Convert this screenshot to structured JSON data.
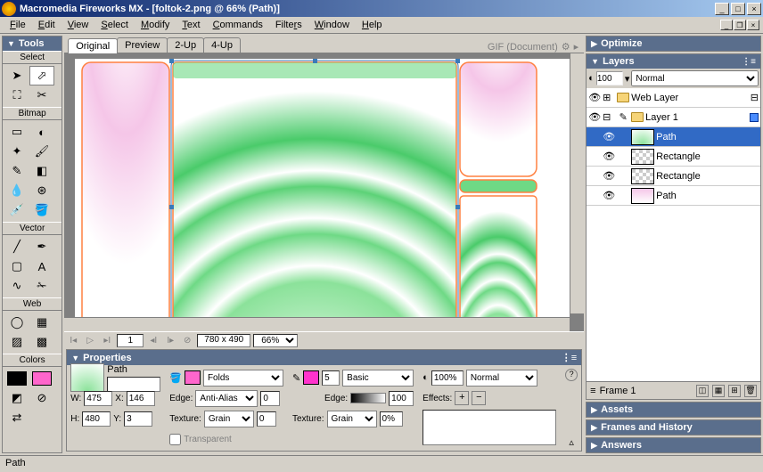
{
  "title": "Macromedia Fireworks MX - [foltok-2.png @  66% (Path)]",
  "menu": [
    "File",
    "Edit",
    "View",
    "Select",
    "Modify",
    "Text",
    "Commands",
    "Filters",
    "Window",
    "Help"
  ],
  "tools_title": "Tools",
  "tool_sections": {
    "select": "Select",
    "bitmap": "Bitmap",
    "vector": "Vector",
    "web": "Web",
    "colors": "Colors"
  },
  "doc_tabs": [
    "Original",
    "Preview",
    "2-Up",
    "4-Up"
  ],
  "doc_type_label": "GIF (Document)",
  "canvas_size": "780 x 490",
  "zoom": "66%",
  "page_num": "1",
  "panels": {
    "optimize": "Optimize",
    "layers": "Layers",
    "assets": "Assets",
    "frames": "Frames and History",
    "answers": "Answers"
  },
  "layers": {
    "opacity": "100",
    "blend": "Normal",
    "items": [
      {
        "name": "Web Layer",
        "type": "web"
      },
      {
        "name": "Layer 1",
        "type": "layer"
      },
      {
        "name": "Path",
        "type": "obj",
        "selected": true
      },
      {
        "name": "Rectangle",
        "type": "obj"
      },
      {
        "name": "Rectangle",
        "type": "obj"
      },
      {
        "name": "Path",
        "type": "obj"
      }
    ],
    "frame_label": "Frame 1"
  },
  "properties": {
    "title": "Properties",
    "object_type": "Path",
    "object_name": "",
    "w": "475",
    "x": "146",
    "h": "480",
    "y": "3",
    "fill_style": "Folds",
    "edge": "Anti-Alias",
    "edge_amt": "0",
    "texture": "Grain",
    "texture_amt": "0",
    "transparent_label": "Transparent",
    "stroke_size": "5",
    "stroke_style": "Basic",
    "stroke_edge": "100",
    "stroke_texture": "Grain",
    "stroke_texture_amt": "0%",
    "opacity": "100%",
    "blend": "Normal",
    "effects_label": "Effects:",
    "edge_label": "Edge:",
    "texture_label": "Texture:",
    "w_label": "W:",
    "h_label": "H:",
    "x_label": "X:",
    "y_label": "Y:"
  },
  "status": "Path",
  "colors": {
    "stroke": "#000000",
    "fill": "#ff66cc"
  }
}
